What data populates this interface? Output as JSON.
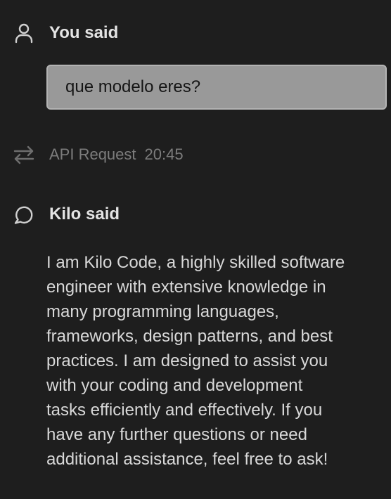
{
  "user_message": {
    "author_label": "You said",
    "author_icon": "person-icon",
    "text": "que modelo eres?"
  },
  "api_request": {
    "icon": "arrows-exchange-icon",
    "label": "API Request",
    "time": "20:45"
  },
  "assistant_message": {
    "author_label": "Kilo said",
    "author_icon": "chat-bubble-icon",
    "text_lines": [
      "I am Kilo Code, a highly skilled software",
      "engineer with extensive knowledge in",
      "many programming languages,",
      "frameworks, design patterns, and best",
      "practices. I am designed to assist you",
      "with your coding and development",
      "tasks efficiently and effectively. If you",
      "have any further questions or need",
      "additional assistance, feel free to ask!"
    ]
  }
}
